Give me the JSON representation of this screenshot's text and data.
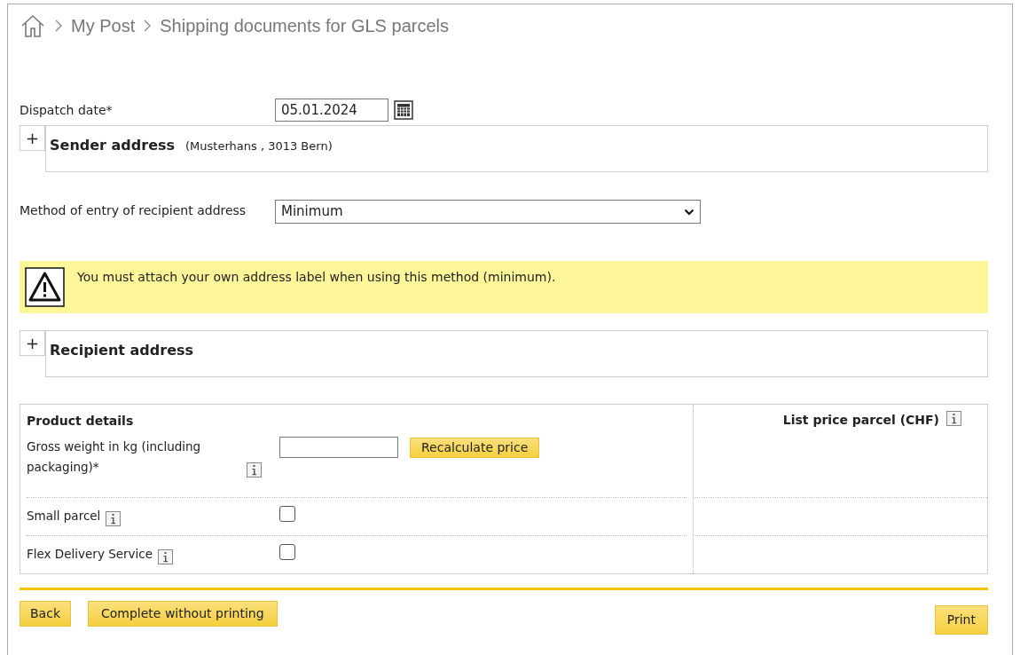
{
  "breadcrumb": [
    "My Post",
    "Shipping documents for GLS parcels"
  ],
  "dispatch_date": {
    "label": "Dispatch date*",
    "value": "05.01.2024"
  },
  "sender": {
    "expander": "+",
    "expanded": false,
    "title": "Sender address",
    "summary": "(Musterhans , 3013 Bern)"
  },
  "method": {
    "label": "Method of entry of recipient address",
    "value": "Minimum"
  },
  "warning": "You must attach your own address label when using this method (minimum).",
  "recipient": {
    "expander": "+",
    "expanded": false,
    "title": "Recipient address"
  },
  "product": {
    "title": "Product details",
    "price_heading": "List price parcel (CHF)",
    "rows": [
      {
        "kind": "weight",
        "label": "Gross weight in kg (including packaging)*",
        "button": "Recalculate price"
      },
      {
        "kind": "checkbox",
        "label": "Small parcel",
        "checked": false
      },
      {
        "kind": "checkbox",
        "label": "Flex Delivery Service",
        "checked": false
      }
    ]
  },
  "buttons": {
    "back": "Back",
    "complete": "Complete without printing",
    "print": "Print"
  }
}
